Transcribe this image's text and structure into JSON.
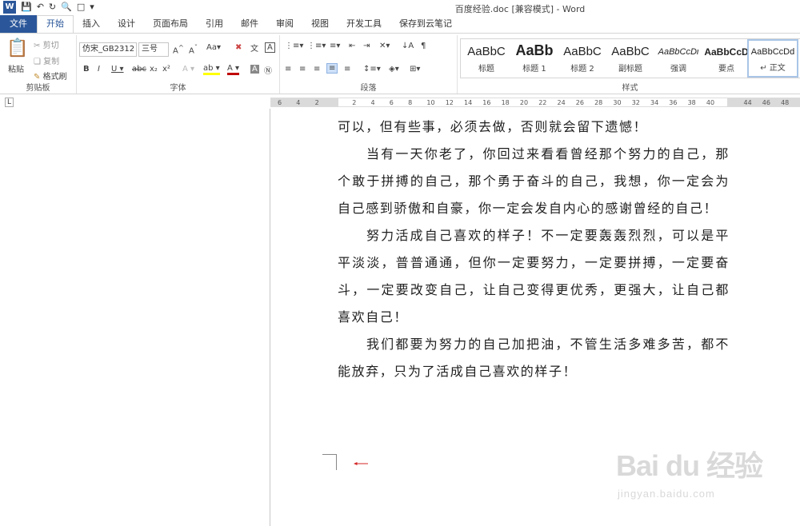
{
  "window": {
    "title": "百度经验.doc [兼容模式] - Word"
  },
  "tabs": [
    "文件",
    "开始",
    "插入",
    "设计",
    "页面布局",
    "引用",
    "邮件",
    "审阅",
    "视图",
    "开发工具",
    "保存到云笔记"
  ],
  "clipboard": {
    "paste": "粘贴",
    "cut": "剪切",
    "copy": "复制",
    "painter": "格式刷",
    "label": "剪贴板"
  },
  "font": {
    "name": "仿宋_GB2312",
    "size": "三号",
    "label": "字体",
    "aa": "Aa",
    "wen": "文"
  },
  "paragraph": {
    "label": "段落"
  },
  "styles": {
    "label": "样式",
    "items": [
      {
        "sample": "AaBbC",
        "label": "标题"
      },
      {
        "sample": "AaBb",
        "label": "标题 1"
      },
      {
        "sample": "AaBbC",
        "label": "标题 2"
      },
      {
        "sample": "AaBbC",
        "label": "副标题"
      },
      {
        "sample": "AaBbCcDι",
        "label": "强调"
      },
      {
        "sample": "AaBbCcD",
        "label": "要点"
      },
      {
        "sample": "AaBbCcDd",
        "label": "↵ 正文"
      }
    ]
  },
  "ruler": {
    "ticks": [
      "6",
      "4",
      "2",
      "",
      "2",
      "4",
      "6",
      "8",
      "10",
      "12",
      "14",
      "16",
      "18",
      "20",
      "22",
      "24",
      "26",
      "28",
      "30",
      "32",
      "34",
      "36",
      "38",
      "40",
      "",
      "44",
      "46",
      "48"
    ]
  },
  "document": {
    "paragraphs": [
      {
        "text": "可以，但有些事，必须去做，否则就会留下遗憾！",
        "indent": false
      },
      {
        "text": "当有一天你老了，你回过来看看曾经那个努力的自己，那个敢于拼搏的自己，那个勇于奋斗的自己，我想，你一定会为自己感到骄傲和自豪，你一定会发自内心的感谢曾经的自己！",
        "indent": true
      },
      {
        "text": "努力活成自己喜欢的样子！不一定要轰轰烈烈，可以是平平淡淡，普普通通，但你一定要努力，一定要拼搏，一定要奋斗，一定要改变自己，让自己变得更优秀，更强大，让自己都喜欢自己！",
        "indent": true
      },
      {
        "text": "我们都要为努力的自己加把油，不管生活多难多苦，都不能放弃，只为了活成自己喜欢的样子！",
        "indent": true
      }
    ]
  },
  "watermark": {
    "brand": "Bai du 经验",
    "url": "jingyan.baidu.com"
  },
  "colors": {
    "accent": "#2b579a",
    "arrow": "#d42424"
  }
}
